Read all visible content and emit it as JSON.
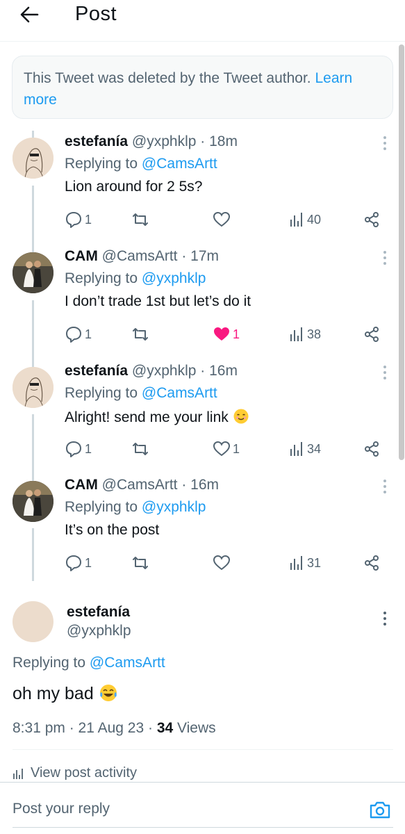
{
  "header": {
    "title": "Post"
  },
  "deleted_notice": {
    "text": "This Tweet was deleted by the Tweet author.",
    "link": "Learn more"
  },
  "colors": {
    "accent": "#1d9bf0",
    "like": "#f91880",
    "secondary_text": "#536471"
  },
  "tweets": [
    {
      "name": "estefanía",
      "handle": "@yxphklp",
      "time": "· 18m",
      "reply_prefix": "Replying to",
      "reply_to": "@CamsArtt",
      "text": "Lion around for 2 5s?",
      "replies": "1",
      "retweets": "",
      "likes": "",
      "liked": false,
      "views": "40",
      "avatar": "sketch-avatar"
    },
    {
      "name": "CAM",
      "handle": "@CamsArtt",
      "time": "· 17m",
      "reply_prefix": "Replying to",
      "reply_to": "@yxphklp",
      "text": "I don’t trade 1st but let’s do it",
      "replies": "1",
      "retweets": "",
      "likes": "1",
      "liked": true,
      "views": "38",
      "avatar": "photo-avatar"
    },
    {
      "name": "estefanía",
      "handle": "@yxphklp",
      "time": "· 16m",
      "reply_prefix": "Replying to",
      "reply_to": "@CamsArtt",
      "text": "Alright! send me your link",
      "emoji": "smiling-face-emoji",
      "replies": "1",
      "retweets": "",
      "likes": "1",
      "liked": false,
      "views": "34",
      "avatar": "sketch-avatar"
    },
    {
      "name": "CAM",
      "handle": "@CamsArtt",
      "time": "· 16m",
      "reply_prefix": "Replying to",
      "reply_to": "@yxphklp",
      "text": "It’s on the post",
      "replies": "1",
      "retweets": "",
      "likes": "",
      "liked": false,
      "views": "31",
      "avatar": "photo-avatar"
    }
  ],
  "focus": {
    "name": "estefanía",
    "handle": "@yxphklp",
    "reply_prefix": "Replying to",
    "reply_to": "@CamsArtt",
    "text": "oh my bad",
    "emoji": "tears-of-joy-emoji",
    "time": "8:31 pm · 21 Aug 23 ·",
    "views_count": "34",
    "views_label": "Views",
    "activity": "View post activity"
  },
  "reply_bar": {
    "placeholder": "Post your reply"
  }
}
